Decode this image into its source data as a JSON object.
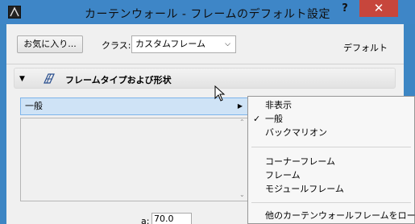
{
  "window": {
    "title": "カーテンウォール - フレームのデフォルト設定",
    "help_label": "?",
    "close_label": "✕"
  },
  "toolbar": {
    "favorites_label": "お気に入り...",
    "class_label": "クラス:",
    "class_value": "カスタムフレーム",
    "default_label": "デフォルト"
  },
  "section": {
    "title": "フレームタイプおよび形状"
  },
  "type_select": {
    "value": "一般"
  },
  "field_a": {
    "label": "a:",
    "value": "70.0"
  },
  "menu": {
    "items": [
      {
        "label": "非表示",
        "checked": false
      },
      {
        "label": "一般",
        "checked": true
      },
      {
        "label": "バックマリオン",
        "checked": false
      },
      {
        "label": "コーナーフレーム",
        "checked": false
      },
      {
        "label": "フレーム",
        "checked": false
      },
      {
        "label": "モジュールフレーム",
        "checked": false
      },
      {
        "label": "他のカーテンウォールフレームをロード...",
        "checked": false
      }
    ],
    "check_glyph": "✓"
  },
  "colors": {
    "titlebar": "#3e86c7",
    "close_button": "#c7463c",
    "selected_highlight": "#cfe3f6"
  }
}
